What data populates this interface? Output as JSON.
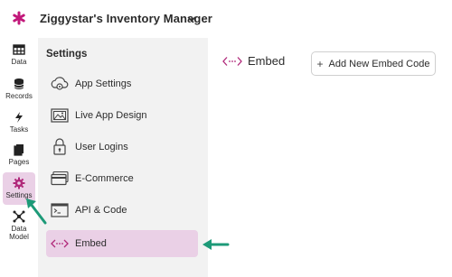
{
  "app": {
    "title": "Ziggystar's Inventory Manager"
  },
  "colors": {
    "brand": "#c2187a",
    "active_bg": "#ead0e6",
    "embed_icon": "#b0287a",
    "callout": "#1d9a78"
  },
  "rail": {
    "items": [
      {
        "label": "Data",
        "icon": "table-icon"
      },
      {
        "label": "Records",
        "icon": "database-icon"
      },
      {
        "label": "Tasks",
        "icon": "lightning-icon"
      },
      {
        "label": "Pages",
        "icon": "pages-icon"
      },
      {
        "label": "Settings",
        "icon": "gear-icon",
        "active": true
      },
      {
        "label": "Data\nModel",
        "icon": "data-model-icon"
      }
    ]
  },
  "settings": {
    "title": "Settings",
    "items": [
      {
        "label": "App Settings",
        "icon": "cloud-gear-icon"
      },
      {
        "label": "Live App Design",
        "icon": "image-icon"
      },
      {
        "label": "User Logins",
        "icon": "lock-icon"
      },
      {
        "label": "E-Commerce",
        "icon": "credit-card-icon"
      },
      {
        "label": "API & Code",
        "icon": "terminal-icon"
      },
      {
        "label": "Embed",
        "icon": "embed-icon",
        "active": true
      }
    ]
  },
  "main": {
    "title": "Embed",
    "add_button": "Add New Embed Code"
  }
}
